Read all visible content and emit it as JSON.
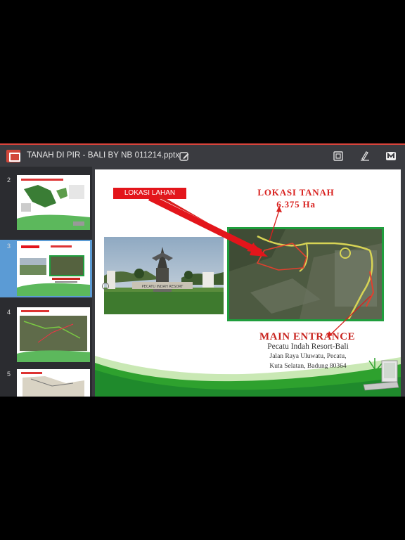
{
  "app": {
    "document_title": "TANAH DI PIR - BALI  BY NB  011214.pptx",
    "icons": [
      "presentation-app-icon",
      "edit-icon",
      "slideshow-icon",
      "pen-icon",
      "more-icon"
    ]
  },
  "thumbnails": [
    {
      "number": "2",
      "selected": false
    },
    {
      "number": "3",
      "selected": true
    },
    {
      "number": "4",
      "selected": false
    },
    {
      "number": "5",
      "selected": false
    }
  ],
  "slide": {
    "label_box": "LOKASI LAHAN",
    "lokasi_title": "LOKASI TANAH",
    "lokasi_area": "6.375 Ha",
    "main_entrance": "MAIN ENTRANCE",
    "address_line1": "Pecatu Indah Resort-Bali",
    "address_line2": "Jalan Raya Uluwatu, Pecatu,",
    "address_line3": "Kuta Selatan, Badung 80364",
    "photo_sign_text": "PECATU INDAH RESORT"
  },
  "colors": {
    "accent_red": "#e3151b",
    "title_red": "#d8201e",
    "frame_green": "#1f9e3d",
    "selection_blue": "#5b9bd5",
    "toolbar": "#3a3b40"
  }
}
